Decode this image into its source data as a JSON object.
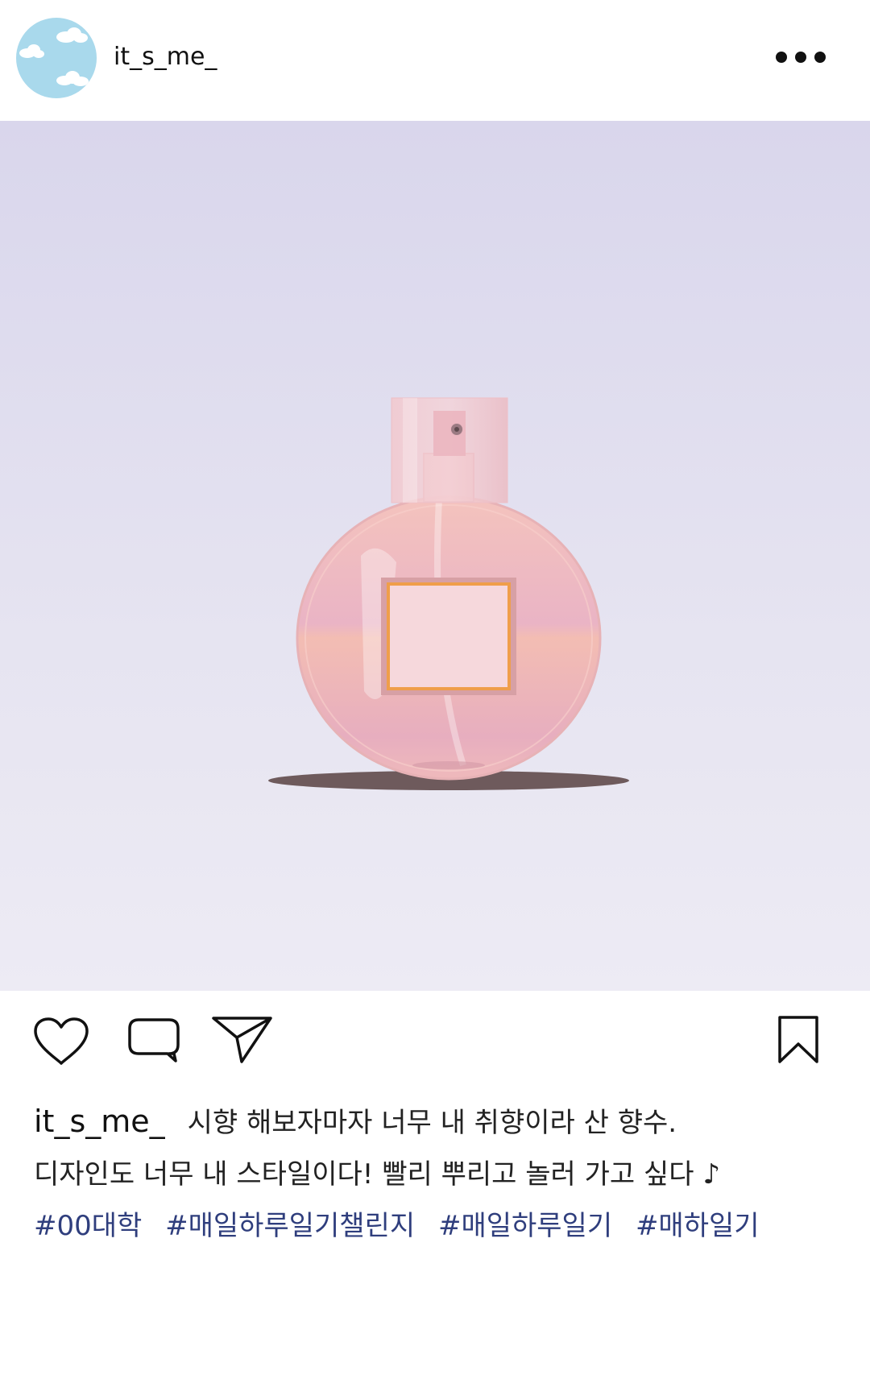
{
  "post": {
    "username": "it_s_me_",
    "more_icon": "more-horizontal-icon",
    "image_subject": "perfume-bottle",
    "colors": {
      "photo_bg_top": "#d9d6ec",
      "photo_bg_bottom": "#edebf4",
      "bottle": "#f2b7b4",
      "hashtag": "#2f3e7d",
      "avatar": "#a9d9ec"
    }
  },
  "actions": {
    "like_icon": "heart-icon",
    "comment_icon": "comment-icon",
    "share_icon": "send-icon",
    "save_icon": "bookmark-icon"
  },
  "caption": {
    "username": "it_s_me_",
    "line1": "시향 해보자마자 너무 내 취향이라 산 향수.",
    "line2": "디자인도 너무 내 스타일이다! 빨리 뿌리고 놀러 가고 싶다 ♪",
    "hashtags": [
      "#00대학",
      "#매일하루일기챌린지",
      "#매일하루일기",
      "#매하일기"
    ]
  }
}
